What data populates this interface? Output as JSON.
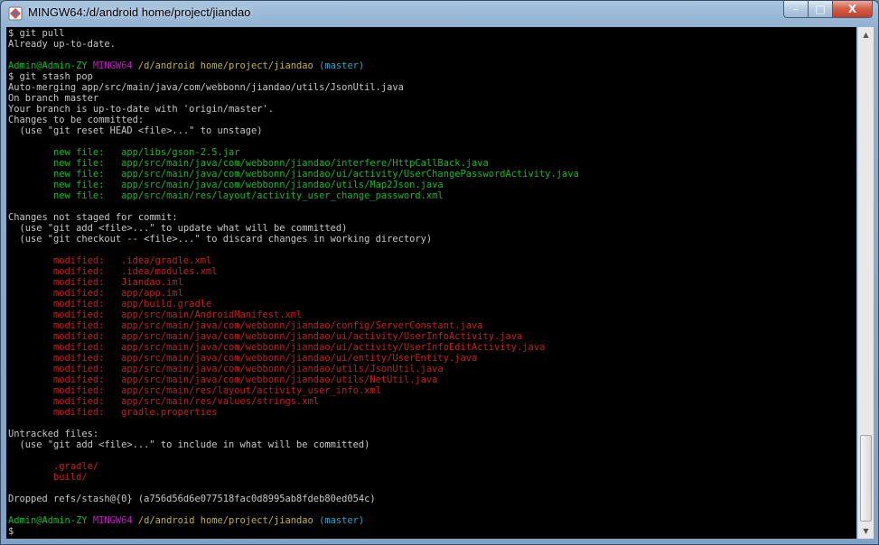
{
  "window": {
    "title": "MINGW64:/d/android home/project/jiandao",
    "controls": {
      "minimize": "–",
      "maximize": "□",
      "close": "X"
    }
  },
  "colors": {
    "prompt_user": "#0dbc2a",
    "prompt_shell": "#c020c0",
    "prompt_path": "#c9b52a",
    "prompt_branch": "#22a8c8",
    "staged": "#0dbc2a",
    "unstaged": "#c42020",
    "text": "#bfbfbf"
  },
  "terminal": {
    "lines": [
      [
        {
          "t": "$ git pull",
          "c": "w"
        }
      ],
      [
        {
          "t": "Already up-to-date.",
          "c": "w"
        }
      ],
      [
        {
          "t": "",
          "c": "w"
        }
      ],
      [
        {
          "t": "Admin@Admin-ZY ",
          "c": "g"
        },
        {
          "t": "MINGW64 ",
          "c": "m"
        },
        {
          "t": "/d/android home/project/jiandao ",
          "c": "y"
        },
        {
          "t": "(master)",
          "c": "c"
        }
      ],
      [
        {
          "t": "$ git stash pop",
          "c": "w"
        }
      ],
      [
        {
          "t": "Auto-merging app/src/main/java/com/webbonn/jiandao/utils/JsonUtil.java",
          "c": "w"
        }
      ],
      [
        {
          "t": "On branch master",
          "c": "w"
        }
      ],
      [
        {
          "t": "Your branch is up-to-date with 'origin/master'.",
          "c": "w"
        }
      ],
      [
        {
          "t": "Changes to be committed:",
          "c": "w"
        }
      ],
      [
        {
          "t": "  (use \"git reset HEAD <file>...\" to unstage)",
          "c": "w"
        }
      ],
      [
        {
          "t": "",
          "c": "w"
        }
      ],
      [
        {
          "t": "        new file:   app/libs/gson-2.5.jar",
          "c": "g"
        }
      ],
      [
        {
          "t": "        new file:   app/src/main/java/com/webbonn/jiandao/interfere/HttpCallBack.java",
          "c": "g"
        }
      ],
      [
        {
          "t": "        new file:   app/src/main/java/com/webbonn/jiandao/ui/activity/UserChangePasswordActivity.java",
          "c": "g"
        }
      ],
      [
        {
          "t": "        new file:   app/src/main/java/com/webbonn/jiandao/utils/Map2Json.java",
          "c": "g"
        }
      ],
      [
        {
          "t": "        new file:   app/src/main/res/layout/activity_user_change_password.xml",
          "c": "g"
        }
      ],
      [
        {
          "t": "",
          "c": "w"
        }
      ],
      [
        {
          "t": "Changes not staged for commit:",
          "c": "w"
        }
      ],
      [
        {
          "t": "  (use \"git add <file>...\" to update what will be committed)",
          "c": "w"
        }
      ],
      [
        {
          "t": "  (use \"git checkout -- <file>...\" to discard changes in working directory)",
          "c": "w"
        }
      ],
      [
        {
          "t": "",
          "c": "w"
        }
      ],
      [
        {
          "t": "        modified:   .idea/gradle.xml",
          "c": "r"
        }
      ],
      [
        {
          "t": "        modified:   .idea/modules.xml",
          "c": "r"
        }
      ],
      [
        {
          "t": "        modified:   Jiandao.iml",
          "c": "r"
        }
      ],
      [
        {
          "t": "        modified:   app/app.iml",
          "c": "r"
        }
      ],
      [
        {
          "t": "        modified:   app/build.gradle",
          "c": "r"
        }
      ],
      [
        {
          "t": "        modified:   app/src/main/AndroidManifest.xml",
          "c": "r"
        }
      ],
      [
        {
          "t": "        modified:   app/src/main/java/com/webbonn/jiandao/config/ServerConstant.java",
          "c": "r"
        }
      ],
      [
        {
          "t": "        modified:   app/src/main/java/com/webbonn/jiandao/ui/activity/UserInfoActivity.java",
          "c": "r"
        }
      ],
      [
        {
          "t": "        modified:   app/src/main/java/com/webbonn/jiandao/ui/activity/UserInfoEditActivity.java",
          "c": "r"
        }
      ],
      [
        {
          "t": "        modified:   app/src/main/java/com/webbonn/jiandao/ui/entity/UserEntity.java",
          "c": "r"
        }
      ],
      [
        {
          "t": "        modified:   app/src/main/java/com/webbonn/jiandao/utils/JsonUtil.java",
          "c": "r"
        }
      ],
      [
        {
          "t": "        modified:   app/src/main/java/com/webbonn/jiandao/utils/NetUtil.java",
          "c": "r"
        }
      ],
      [
        {
          "t": "        modified:   app/src/main/res/layout/activity_user_info.xml",
          "c": "r"
        }
      ],
      [
        {
          "t": "        modified:   app/src/main/res/values/strings.xml",
          "c": "r"
        }
      ],
      [
        {
          "t": "        modified:   gradle.properties",
          "c": "r"
        }
      ],
      [
        {
          "t": "",
          "c": "w"
        }
      ],
      [
        {
          "t": "Untracked files:",
          "c": "w"
        }
      ],
      [
        {
          "t": "  (use \"git add <file>...\" to include in what will be committed)",
          "c": "w"
        }
      ],
      [
        {
          "t": "",
          "c": "w"
        }
      ],
      [
        {
          "t": "        .gradle/",
          "c": "r"
        }
      ],
      [
        {
          "t": "        build/",
          "c": "r"
        }
      ],
      [
        {
          "t": "",
          "c": "w"
        }
      ],
      [
        {
          "t": "Dropped refs/stash@{0} (a756d56d6e077518fac0d8995ab8fdeb80ed054c)",
          "c": "w"
        }
      ],
      [
        {
          "t": "",
          "c": "w"
        }
      ],
      [
        {
          "t": "Admin@Admin-ZY ",
          "c": "g"
        },
        {
          "t": "MINGW64 ",
          "c": "m"
        },
        {
          "t": "/d/android home/project/jiandao ",
          "c": "y"
        },
        {
          "t": "(master)",
          "c": "c"
        }
      ],
      [
        {
          "t": "$ ",
          "c": "w"
        }
      ]
    ]
  }
}
